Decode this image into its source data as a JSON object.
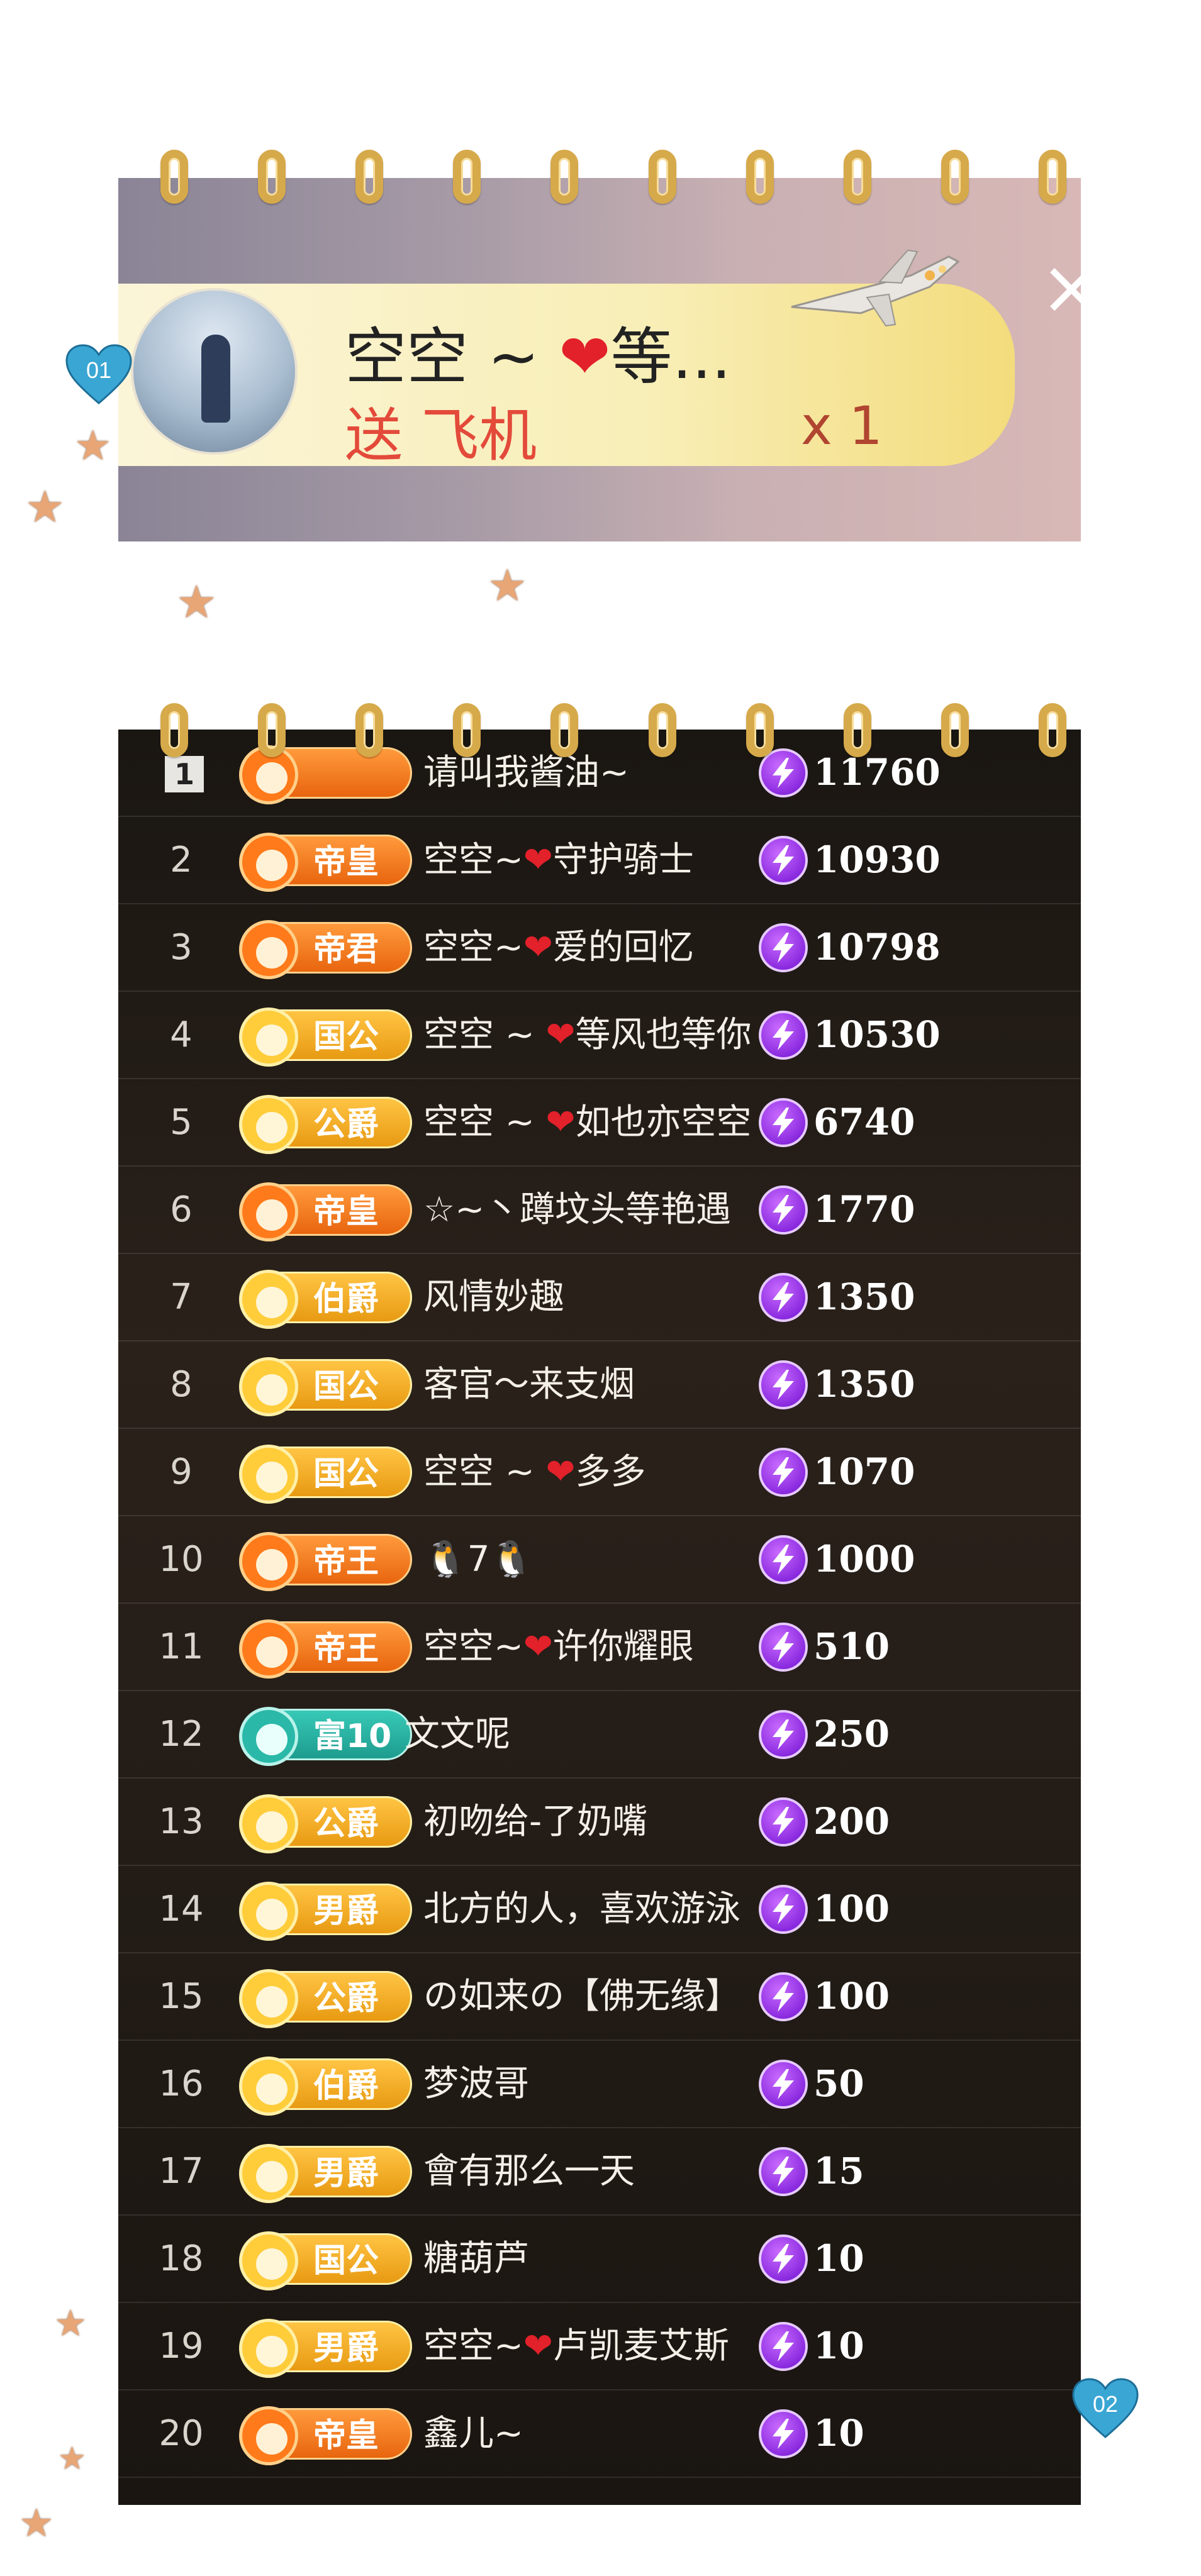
{
  "gift_notification": {
    "user_name": "空空 ~ ❤等...",
    "action": "送 飞机",
    "count": "x 1",
    "close_label": "×"
  },
  "markers": {
    "top": "01",
    "bottom": "02"
  },
  "ranking": [
    {
      "rank": "1",
      "badge": "",
      "badge_type": "orange",
      "name": "请叫我酱油~",
      "value": "11760"
    },
    {
      "rank": "2",
      "badge": "帝皇",
      "badge_type": "orange",
      "name": "空空~❤守护骑士",
      "value": "10930"
    },
    {
      "rank": "3",
      "badge": "帝君",
      "badge_type": "orange",
      "name": "空空~❤爱的回忆",
      "value": "10798"
    },
    {
      "rank": "4",
      "badge": "国公",
      "badge_type": "gold",
      "name": "空空 ~ ❤等风也等你",
      "value": "10530"
    },
    {
      "rank": "5",
      "badge": "公爵",
      "badge_type": "gold",
      "name": "空空 ~ ❤如也亦空空",
      "value": "6740"
    },
    {
      "rank": "6",
      "badge": "帝皇",
      "badge_type": "orange",
      "name": "☆~丶蹲坟头等艳遇",
      "value": "1770"
    },
    {
      "rank": "7",
      "badge": "伯爵",
      "badge_type": "gold",
      "name": "风情妙趣",
      "value": "1350"
    },
    {
      "rank": "8",
      "badge": "国公",
      "badge_type": "gold",
      "name": "客官～来支烟",
      "value": "1350"
    },
    {
      "rank": "9",
      "badge": "国公",
      "badge_type": "gold",
      "name": "空空 ~ ❤多多",
      "value": "1070"
    },
    {
      "rank": "10",
      "badge": "帝王",
      "badge_type": "orange",
      "name": "🐧7🐧",
      "value": "1000"
    },
    {
      "rank": "11",
      "badge": "帝王",
      "badge_type": "orange",
      "name": "空空~❤许你耀眼",
      "value": "510"
    },
    {
      "rank": "12",
      "badge": "富10",
      "badge_type": "teal",
      "name": "文文呢",
      "value": "250"
    },
    {
      "rank": "13",
      "badge": "公爵",
      "badge_type": "gold",
      "name": "初吻给-了奶嘴",
      "value": "200"
    },
    {
      "rank": "14",
      "badge": "男爵",
      "badge_type": "gold",
      "name": "北方的人，喜欢游泳",
      "value": "100"
    },
    {
      "rank": "15",
      "badge": "公爵",
      "badge_type": "gold",
      "name": "の如来の【佛无缘】",
      "value": "100"
    },
    {
      "rank": "16",
      "badge": "伯爵",
      "badge_type": "gold",
      "name": "梦波哥",
      "value": "50"
    },
    {
      "rank": "17",
      "badge": "男爵",
      "badge_type": "gold",
      "name": "會有那么一天",
      "value": "15"
    },
    {
      "rank": "18",
      "badge": "国公",
      "badge_type": "gold",
      "name": "糖葫芦",
      "value": "10"
    },
    {
      "rank": "19",
      "badge": "男爵",
      "badge_type": "gold",
      "name": "空空~❤卢凯麦艾斯",
      "value": "10"
    },
    {
      "rank": "20",
      "badge": "帝皇",
      "badge_type": "orange",
      "name": "鑫儿~",
      "value": "10"
    }
  ],
  "colors": {
    "orange_badge": "#f07a1e",
    "gold_badge": "#f0a91c",
    "teal_badge": "#2ab8a8",
    "bolt": "#8b2be0",
    "gift_action": "#e34a3a"
  },
  "icons": {
    "gift": "airplane-icon",
    "close": "close-icon",
    "value": "lightning-bolt-icon",
    "marker": "heart-icon",
    "decoration": "star-icon"
  }
}
